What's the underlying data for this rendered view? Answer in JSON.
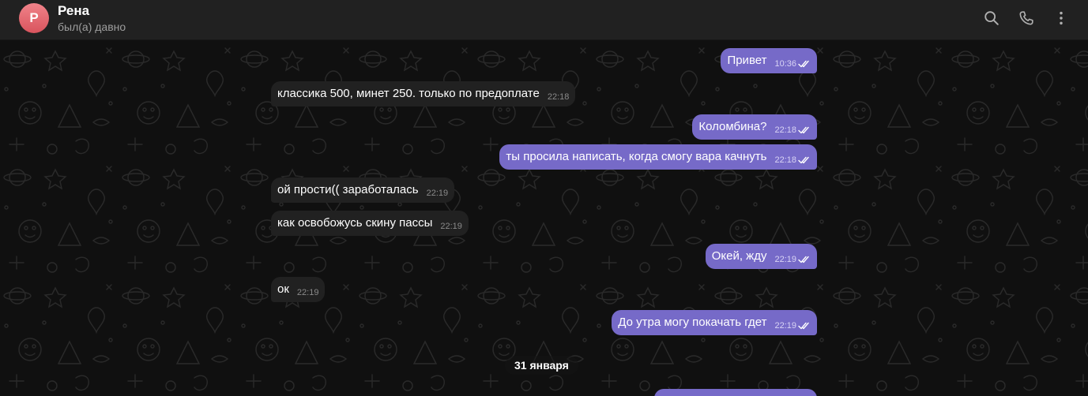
{
  "header": {
    "avatar_letter": "Р",
    "name": "Рена",
    "status": "был(а) давно",
    "icons": [
      "search-icon",
      "phone-icon",
      "more-vert-icon"
    ],
    "avatar_color": "#e0646c"
  },
  "colors": {
    "outgoing_bubble": "#766ac8",
    "incoming_bubble": "#212121",
    "background": "#0f0f0f",
    "header": "#212121"
  },
  "messages": [
    {
      "direction": "out",
      "text": "Привет",
      "time": "10:36",
      "read": true
    },
    {
      "direction": "in",
      "text": "классика 500, минет 250. только по предоплате",
      "time": "22:18"
    },
    {
      "direction": "out",
      "text": "Коломбина?",
      "time": "22:18",
      "read": true
    },
    {
      "direction": "out",
      "text": "ты просила написать, когда смогу вара качнуть",
      "time": "22:18",
      "read": true
    },
    {
      "direction": "in",
      "text": "ой прости(( заработалась",
      "time": "22:19"
    },
    {
      "direction": "in",
      "text": "как освобожусь скину пассы",
      "time": "22:19"
    },
    {
      "direction": "out",
      "text": "Окей, жду",
      "time": "22:19",
      "read": true
    },
    {
      "direction": "in",
      "text": "ок",
      "time": "22:19"
    },
    {
      "direction": "out",
      "text": "До утра могу покачать гдет",
      "time": "22:19",
      "read": true
    }
  ],
  "date_separator": "31 января"
}
